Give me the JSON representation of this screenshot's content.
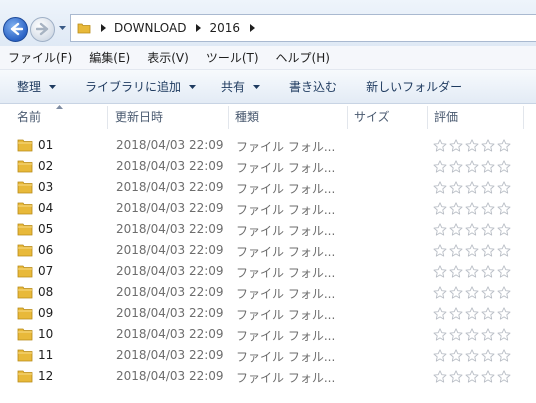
{
  "address": {
    "crumbs": [
      "DOWNLOAD",
      "2016"
    ]
  },
  "menu": [
    "ファイル(F)",
    "編集(E)",
    "表示(V)",
    "ツール(T)",
    "ヘルプ(H)"
  ],
  "toolbar": {
    "organize": "整理",
    "add_to_library": "ライブラリに追加",
    "share": "共有",
    "burn": "書き込む",
    "new_folder": "新しいフォルダー"
  },
  "columns": {
    "name": "名前",
    "date": "更新日時",
    "type": "種類",
    "size": "サイズ",
    "rating": "評価"
  },
  "rows": [
    {
      "name": "01",
      "date": "2018/04/03 22:09",
      "type": "ファイル フォル..."
    },
    {
      "name": "02",
      "date": "2018/04/03 22:09",
      "type": "ファイル フォル..."
    },
    {
      "name": "03",
      "date": "2018/04/03 22:09",
      "type": "ファイル フォル..."
    },
    {
      "name": "04",
      "date": "2018/04/03 22:09",
      "type": "ファイル フォル..."
    },
    {
      "name": "05",
      "date": "2018/04/03 22:09",
      "type": "ファイル フォル..."
    },
    {
      "name": "06",
      "date": "2018/04/03 22:09",
      "type": "ファイル フォル..."
    },
    {
      "name": "07",
      "date": "2018/04/03 22:09",
      "type": "ファイル フォル..."
    },
    {
      "name": "08",
      "date": "2018/04/03 22:09",
      "type": "ファイル フォル..."
    },
    {
      "name": "09",
      "date": "2018/04/03 22:09",
      "type": "ファイル フォル..."
    },
    {
      "name": "10",
      "date": "2018/04/03 22:09",
      "type": "ファイル フォル..."
    },
    {
      "name": "11",
      "date": "2018/04/03 22:09",
      "type": "ファイル フォル..."
    },
    {
      "name": "12",
      "date": "2018/04/03 22:09",
      "type": "ファイル フォル..."
    }
  ],
  "rating_stars": 5,
  "colors": {
    "folder": "#e8b93a",
    "star_outline": "#b9bec6",
    "accent": "#1e3a5f"
  }
}
